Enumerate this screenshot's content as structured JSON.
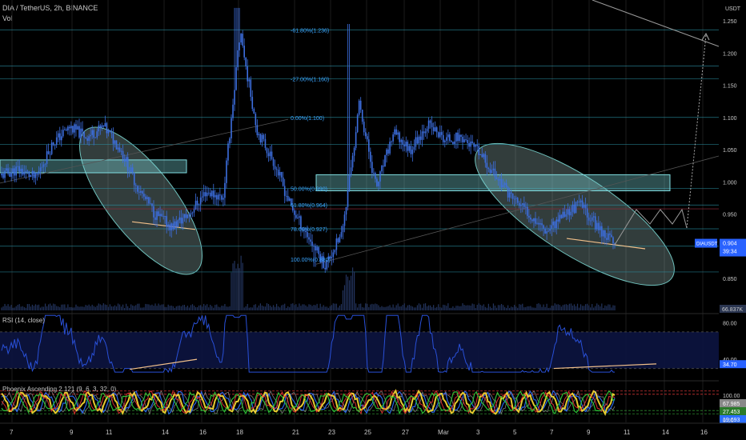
{
  "header": {
    "symbol_line": "DIA / TetherUS, 2h, BINANCE",
    "vol_label": "Vol",
    "currency": "USDT"
  },
  "colors": {
    "background": "#000000",
    "candle": "#3d6fe0",
    "grid": "#1c1c1c",
    "fib_line": "#2a93a6",
    "fib_text": "#3aa5ff",
    "zone_fill": "#7fdce0",
    "ellipse_fill": "#b4dcd7",
    "support_line": "#f2c08a",
    "rsi_line": "#2950d8",
    "rsi_band": "#0c1440",
    "price_badge": "#2962ff"
  },
  "price_axis": {
    "ticks": [
      "1.250",
      "1.200",
      "1.150",
      "1.100",
      "1.050",
      "1.000",
      "0.950",
      "0.900",
      "0.850"
    ],
    "last_price": "0.904",
    "symbol_tag": "DIAUSDT",
    "countdown": "39:34",
    "volume_tag": "66.837K"
  },
  "time_axis": {
    "ticks": [
      "7",
      "9",
      "11",
      "14",
      "16",
      "18",
      "21",
      "23",
      "25",
      "27",
      "Mar",
      "3",
      "5",
      "7",
      "9",
      "11",
      "14",
      "16"
    ]
  },
  "fib_levels": [
    {
      "label": "-61.80%(1.236)",
      "price": 1.236
    },
    {
      "label": "-27.00%(1.160)",
      "price": 1.16
    },
    {
      "label": "0.00%(1.100)",
      "price": 1.1
    },
    {
      "label": "50.00%(0.990)",
      "price": 0.99
    },
    {
      "label": "61.80%(0.964)",
      "price": 0.964
    },
    {
      "label": "78.60%(0.927)",
      "price": 0.927
    },
    {
      "label": "100.00%(0.880)",
      "price": 0.88
    }
  ],
  "rsi_panel": {
    "title": "RSI (14, close)",
    "ticks": [
      "80.00",
      "40.00"
    ],
    "current": "34.70"
  },
  "phoenix_panel": {
    "title": "Phoenix Ascending 2.121 (9, 6, 3, 32, 0)",
    "ticks": [
      "100.00",
      "0.00"
    ],
    "values": [
      "67.985",
      "27.453",
      "19.693"
    ]
  },
  "chart_data": {
    "type": "candlestick",
    "title": "DIA / TetherUS, 2h, BINANCE",
    "ylim": [
      0.82,
      1.27
    ],
    "x": [
      "7",
      "9",
      "11",
      "14",
      "16",
      "18",
      "21",
      "23",
      "25",
      "27",
      "Mar",
      "3",
      "5",
      "7",
      "9",
      "11"
    ],
    "close_path": [
      1.01,
      1.02,
      1.005,
      1.06,
      1.085,
      1.07,
      1.085,
      1.05,
      0.99,
      0.95,
      0.93,
      0.95,
      0.985,
      0.975,
      1.23,
      1.08,
      1.03,
      0.96,
      0.915,
      0.87,
      0.92,
      1.12,
      0.99,
      1.075,
      1.05,
      1.09,
      1.065,
      1.07,
      1.045,
      1.01,
      0.975,
      0.95,
      0.925,
      0.95,
      0.965,
      0.93,
      0.904
    ],
    "last_price": 0.904,
    "horizontal_lines": [
      1.236,
      1.18,
      1.16,
      1.1,
      1.058,
      0.99,
      0.964,
      0.958,
      0.927,
      0.9,
      0.86
    ],
    "rsi": {
      "ylim": [
        20,
        90
      ],
      "overbought": 70,
      "oversold": 30,
      "current": 34.7
    },
    "phoenix": {
      "current": [
        67.985,
        27.453,
        19.693
      ]
    }
  }
}
